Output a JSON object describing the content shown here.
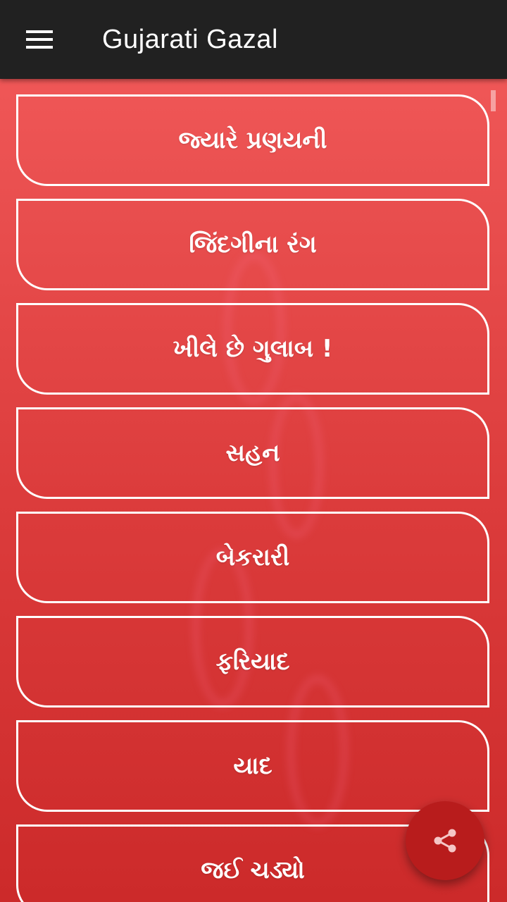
{
  "app_bar": {
    "title": "Gujarati Gazal",
    "menu_icon": "hamburger-menu-icon",
    "background": "#212121"
  },
  "list": {
    "items": [
      {
        "label": "જ્યારે પ્રણયની"
      },
      {
        "label": "જિંદગીના રંગ"
      },
      {
        "label": "ખીલે છે ગુલાબ !"
      },
      {
        "label": "સહન"
      },
      {
        "label": "બેકરારી"
      },
      {
        "label": "ફરિયાદ"
      },
      {
        "label": "યાદ"
      },
      {
        "label": "જઈ ચડ્યો"
      }
    ]
  },
  "fab": {
    "icon": "share-icon",
    "color": "#b81c1c"
  },
  "colors": {
    "background_top": "#f45c5c",
    "background_bottom": "#cc2a2a",
    "item_border": "#ffffff",
    "item_text": "#ffffff"
  }
}
